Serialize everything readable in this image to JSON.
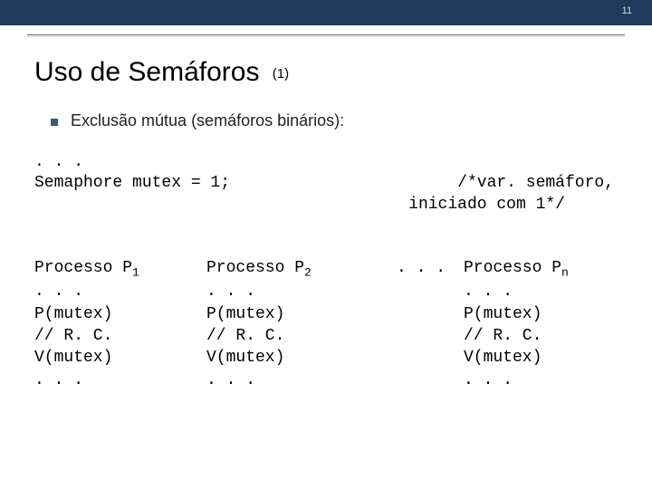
{
  "page_number": "11",
  "title_main": "Uso de Semáforos",
  "title_suffix": "(1)",
  "bullet": "Exclusão mútua (semáforos binários):",
  "decl_dots": ". . .",
  "decl_line": "Semaphore mutex = 1;",
  "comment_l1": "     /*var. semáforo,",
  "comment_l2": "iniciado com 1*/",
  "proc1_head_pre": "Processo P",
  "proc1_head_sub": "1",
  "proc2_head_pre": "Processo P",
  "proc2_head_sub": "2",
  "procn_head_pre": "Processo P",
  "procn_head_sub": "n",
  "ellipsis_sep": ". . .",
  "body_dots": ". . .",
  "body_p": "P(mutex)",
  "body_rc": "// R. C.",
  "body_v": "V(mutex)",
  "body_dots2": ". . ."
}
